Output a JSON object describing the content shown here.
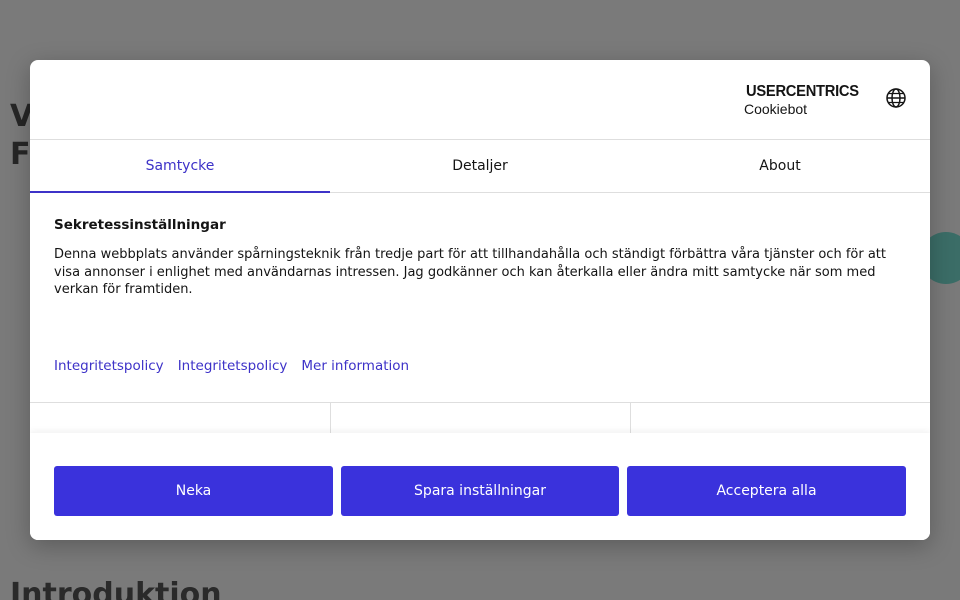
{
  "background": {
    "heading": "V\nF",
    "intro": "Introduktion"
  },
  "dialog": {
    "brand": {
      "name": "USERCENTRICS",
      "sub": "Cookiebot"
    },
    "language_icon": "globe-icon",
    "tabs": [
      {
        "label": "Samtycke",
        "active": true
      },
      {
        "label": "Detaljer",
        "active": false
      },
      {
        "label": "About",
        "active": false
      }
    ],
    "content": {
      "title": "Sekretessinställningar",
      "text": "Denna webbplats använder spårningsteknik från tredje part för att tillhandahålla och ständigt förbättra våra tjänster och för att visa annonser i enlighet med användarnas intressen. Jag godkänner och kan återkalla eller ändra mitt samtycke när som med verkan för framtiden."
    },
    "links": [
      "Integritetspolicy",
      "Integritetspolicy",
      "Mer information"
    ],
    "buttons": {
      "deny": "Neka",
      "save": "Spara inställningar",
      "accept": "Acceptera alla"
    }
  },
  "colors": {
    "accent": "#3d32c8",
    "button": "#3a32dc",
    "overlay": "#7a7a7a"
  }
}
